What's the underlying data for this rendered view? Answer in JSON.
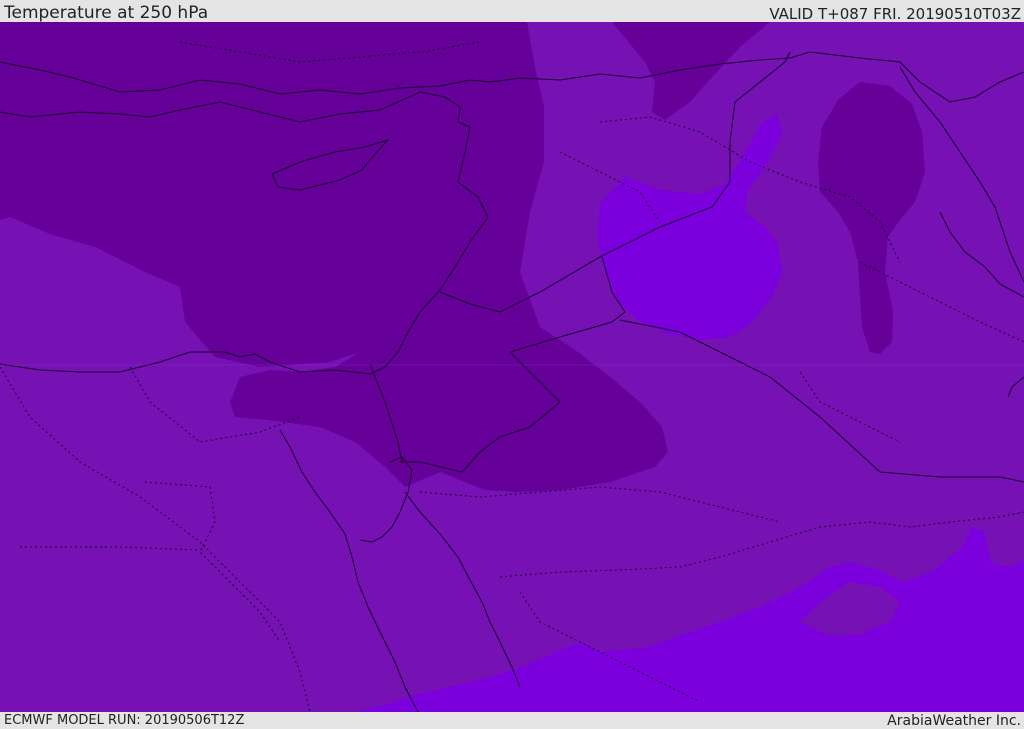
{
  "header": {
    "title": "Temperature at 250 hPa",
    "valid_time": "VALID T+087 FRI. 20190510T03Z"
  },
  "footer": {
    "model_run": "ECMWF MODEL RUN: 20190506T12Z",
    "credit": "ArabiaWeather Inc."
  },
  "colors": {
    "background": "#e4e4e4",
    "cold_dark": "#650099",
    "mid": "#7612b4",
    "warm_light": "#7b00dd",
    "borders": "#1a0030"
  }
}
